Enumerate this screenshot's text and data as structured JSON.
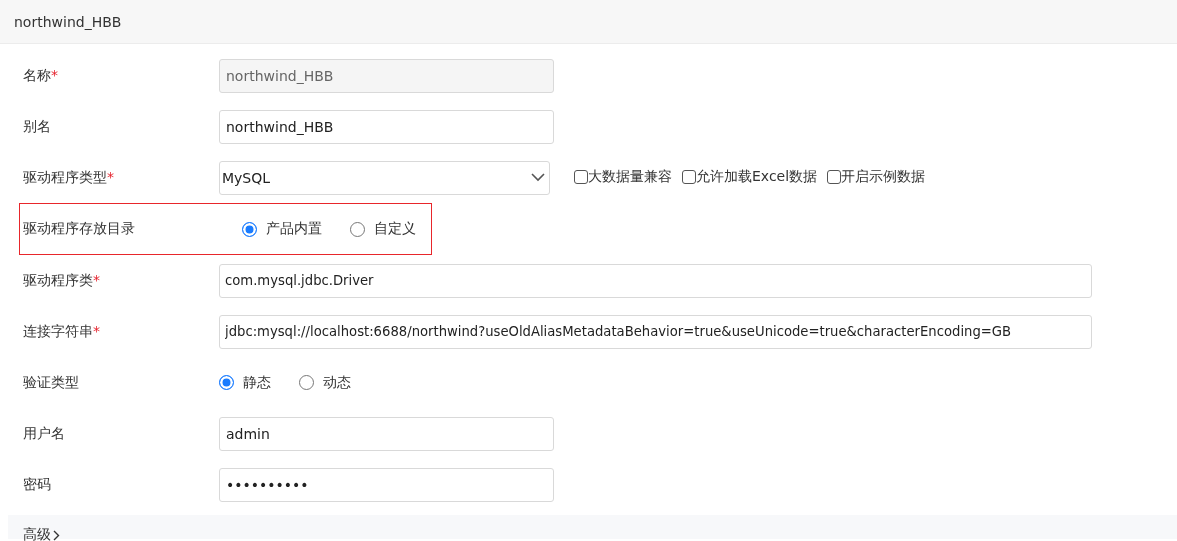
{
  "title": "northwind_HBB",
  "fields": [
    {
      "kind": "text",
      "label": "名称",
      "required_mark": "*",
      "value": "northwind_HBB",
      "disabled": true,
      "wide": false,
      "highlighted": false
    },
    {
      "kind": "text",
      "label": "别名",
      "value": "northwind_HBB",
      "disabled": false,
      "wide": false,
      "highlighted": false
    },
    {
      "kind": "select",
      "label": "驱动程序类型",
      "required_mark": "*",
      "value": "MySQL",
      "highlighted": false,
      "checkboxes": [
        {
          "label": "大数据量兼容",
          "checked": false
        },
        {
          "label": "允许加载Excel数据",
          "checked": false
        },
        {
          "label": "开启示例数据",
          "checked": false
        }
      ]
    },
    {
      "kind": "radio",
      "label": "驱动程序存放目录",
      "highlighted": true,
      "options": [
        {
          "label": "产品内置",
          "selected": true
        },
        {
          "label": "自定义",
          "selected": false
        }
      ]
    },
    {
      "kind": "text",
      "label": "驱动程序类",
      "required_mark": "*",
      "value": "com.mysql.jdbc.Driver",
      "disabled": false,
      "wide": true,
      "highlighted": false
    },
    {
      "kind": "text",
      "label": "连接字符串",
      "required_mark": "*",
      "value": "jdbc:mysql://localhost:6688/northwind?useOldAliasMetadataBehavior=true&useUnicode=true&characterEncoding=GB",
      "disabled": false,
      "wide": true,
      "highlighted": false
    },
    {
      "kind": "radio",
      "label": "验证类型",
      "highlighted": false,
      "options": [
        {
          "label": "静态",
          "selected": true
        },
        {
          "label": "动态",
          "selected": false
        }
      ]
    },
    {
      "kind": "text",
      "label": "用户名",
      "value": "admin",
      "disabled": false,
      "wide": false,
      "highlighted": false
    },
    {
      "kind": "text",
      "label": "密码",
      "value": "••••••••••",
      "disabled": false,
      "wide": false,
      "highlighted": false
    }
  ],
  "advanced": {
    "label": "高级",
    "expanded": false
  }
}
